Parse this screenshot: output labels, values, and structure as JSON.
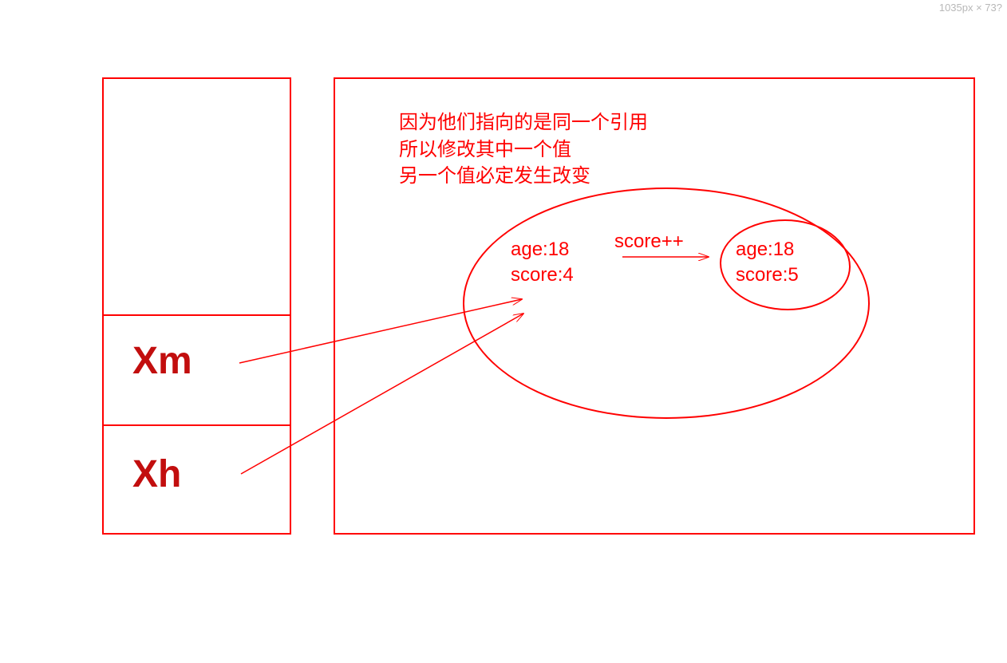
{
  "dimensionLabel": "1035px × 73?",
  "stack": {
    "var1": "Xm",
    "var2": "Xh"
  },
  "heap": {
    "explanation": {
      "line1": "因为他们指向的是同一个引用",
      "line2": "所以修改其中一个值",
      "line3": "另一个值必定发生改变"
    },
    "objectBefore": {
      "ageLabel": "age:18",
      "scoreLabel": "score:4"
    },
    "operation": "score++",
    "objectAfter": {
      "ageLabel": "age:18",
      "scoreLabel": "score:5"
    }
  },
  "colors": {
    "stroke": "#ff0000"
  }
}
